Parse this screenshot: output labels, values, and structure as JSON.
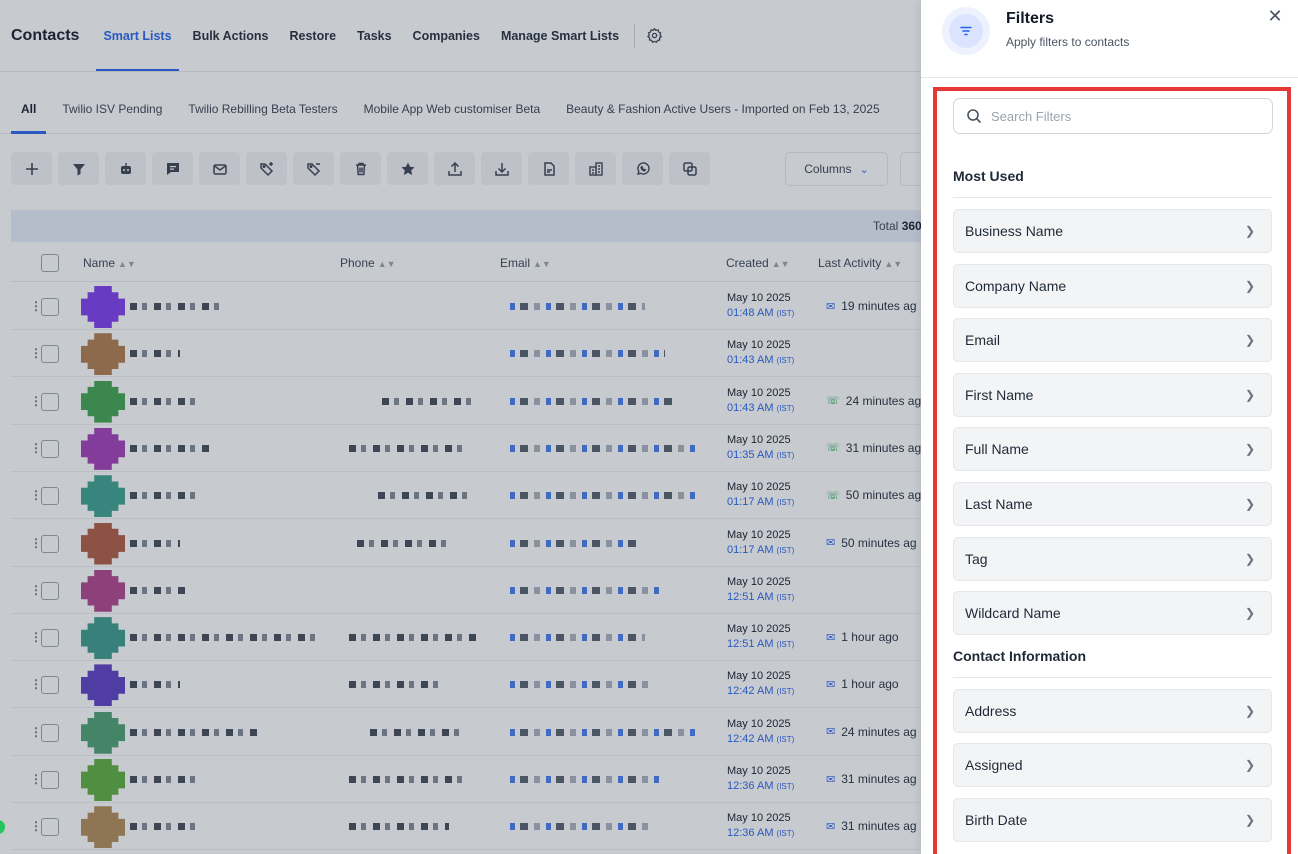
{
  "topnav": {
    "title": "Contacts",
    "links": [
      {
        "label": "Smart Lists",
        "active": true
      },
      {
        "label": "Bulk Actions",
        "active": false
      },
      {
        "label": "Restore",
        "active": false
      },
      {
        "label": "Tasks",
        "active": false
      },
      {
        "label": "Companies",
        "active": false
      },
      {
        "label": "Manage Smart Lists",
        "active": false
      }
    ]
  },
  "tabs": [
    "All",
    "Twilio ISV Pending",
    "Twilio Rebilling Beta Testers",
    "Mobile App Web customiser Beta",
    "Beauty & Fashion Active Users - Imported on Feb 13, 2025"
  ],
  "toolbar": {
    "icons": [
      "plus-icon",
      "filter-icon",
      "robot-icon",
      "message-icon",
      "mail-icon",
      "tag-add-icon",
      "tag-remove-icon",
      "trash-icon",
      "star-icon",
      "upload-icon",
      "download-icon",
      "pdf-icon",
      "building-icon",
      "whatsapp-icon",
      "merge-icon"
    ],
    "columns_label": "Columns"
  },
  "total": {
    "label": "Total",
    "value": "360"
  },
  "table": {
    "headers": {
      "name": "Name",
      "phone": "Phone",
      "email": "Email",
      "created": "Created",
      "last_activity": "Last Activity"
    },
    "rows": [
      {
        "avatar": "#7c3aed",
        "date": "May 10 2025",
        "time": "01:48 AM",
        "tz": "(IST)",
        "activity": "19 minutes ag",
        "activity_icon": "mail"
      },
      {
        "avatar": "#b07a4a",
        "date": "May 10 2025",
        "time": "01:43 AM",
        "tz": "(IST)",
        "activity": "",
        "activity_icon": ""
      },
      {
        "avatar": "#3fa34d",
        "date": "May 10 2025",
        "time": "01:43 AM",
        "tz": "(IST)",
        "activity": "24 minutes ag",
        "activity_icon": "whatsapp"
      },
      {
        "avatar": "#a23bb8",
        "date": "May 10 2025",
        "time": "01:35 AM",
        "tz": "(IST)",
        "activity": "31 minutes ag",
        "activity_icon": "whatsapp"
      },
      {
        "avatar": "#3aa08e",
        "date": "May 10 2025",
        "time": "01:17 AM",
        "tz": "(IST)",
        "activity": "50 minutes ag",
        "activity_icon": "whatsapp"
      },
      {
        "avatar": "#b0593f",
        "date": "May 10 2025",
        "time": "01:17 AM",
        "tz": "(IST)",
        "activity": "50 minutes ag",
        "activity_icon": "mail"
      },
      {
        "avatar": "#b0408a",
        "date": "May 10 2025",
        "time": "12:51 AM",
        "tz": "(IST)",
        "activity": "",
        "activity_icon": ""
      },
      {
        "avatar": "#3a9a8a",
        "date": "May 10 2025",
        "time": "12:51 AM",
        "tz": "(IST)",
        "activity": "1 hour ago",
        "activity_icon": "mail"
      },
      {
        "avatar": "#5b3cc4",
        "date": "May 10 2025",
        "time": "12:42 AM",
        "tz": "(IST)",
        "activity": "1 hour ago",
        "activity_icon": "mail"
      },
      {
        "avatar": "#4aa070",
        "date": "May 10 2025",
        "time": "12:42 AM",
        "tz": "(IST)",
        "activity": "24 minutes ag",
        "activity_icon": "mail"
      },
      {
        "avatar": "#5aae3c",
        "date": "May 10 2025",
        "time": "12:36 AM",
        "tz": "(IST)",
        "activity": "31 minutes ag",
        "activity_icon": "mail"
      },
      {
        "avatar": "#b08a55",
        "date": "May 10 2025",
        "time": "12:36 AM",
        "tz": "(IST)",
        "activity": "31 minutes ag",
        "activity_icon": "mail"
      }
    ]
  },
  "panel": {
    "title": "Filters",
    "subtitle": "Apply filters to contacts",
    "close_icon": "close-icon",
    "search_placeholder": "Search Filters",
    "sections": [
      {
        "title": "Most Used",
        "items": [
          "Business Name",
          "Company Name",
          "Email",
          "First Name",
          "Full Name",
          "Last Name",
          "Tag",
          "Wildcard Name"
        ]
      },
      {
        "title": "Contact Information",
        "items": [
          "Address",
          "Assigned",
          "Birth Date"
        ]
      }
    ]
  },
  "colors": {
    "accent": "#2563eb",
    "highlight": "#e53935",
    "whatsapp": "#16a34a"
  }
}
